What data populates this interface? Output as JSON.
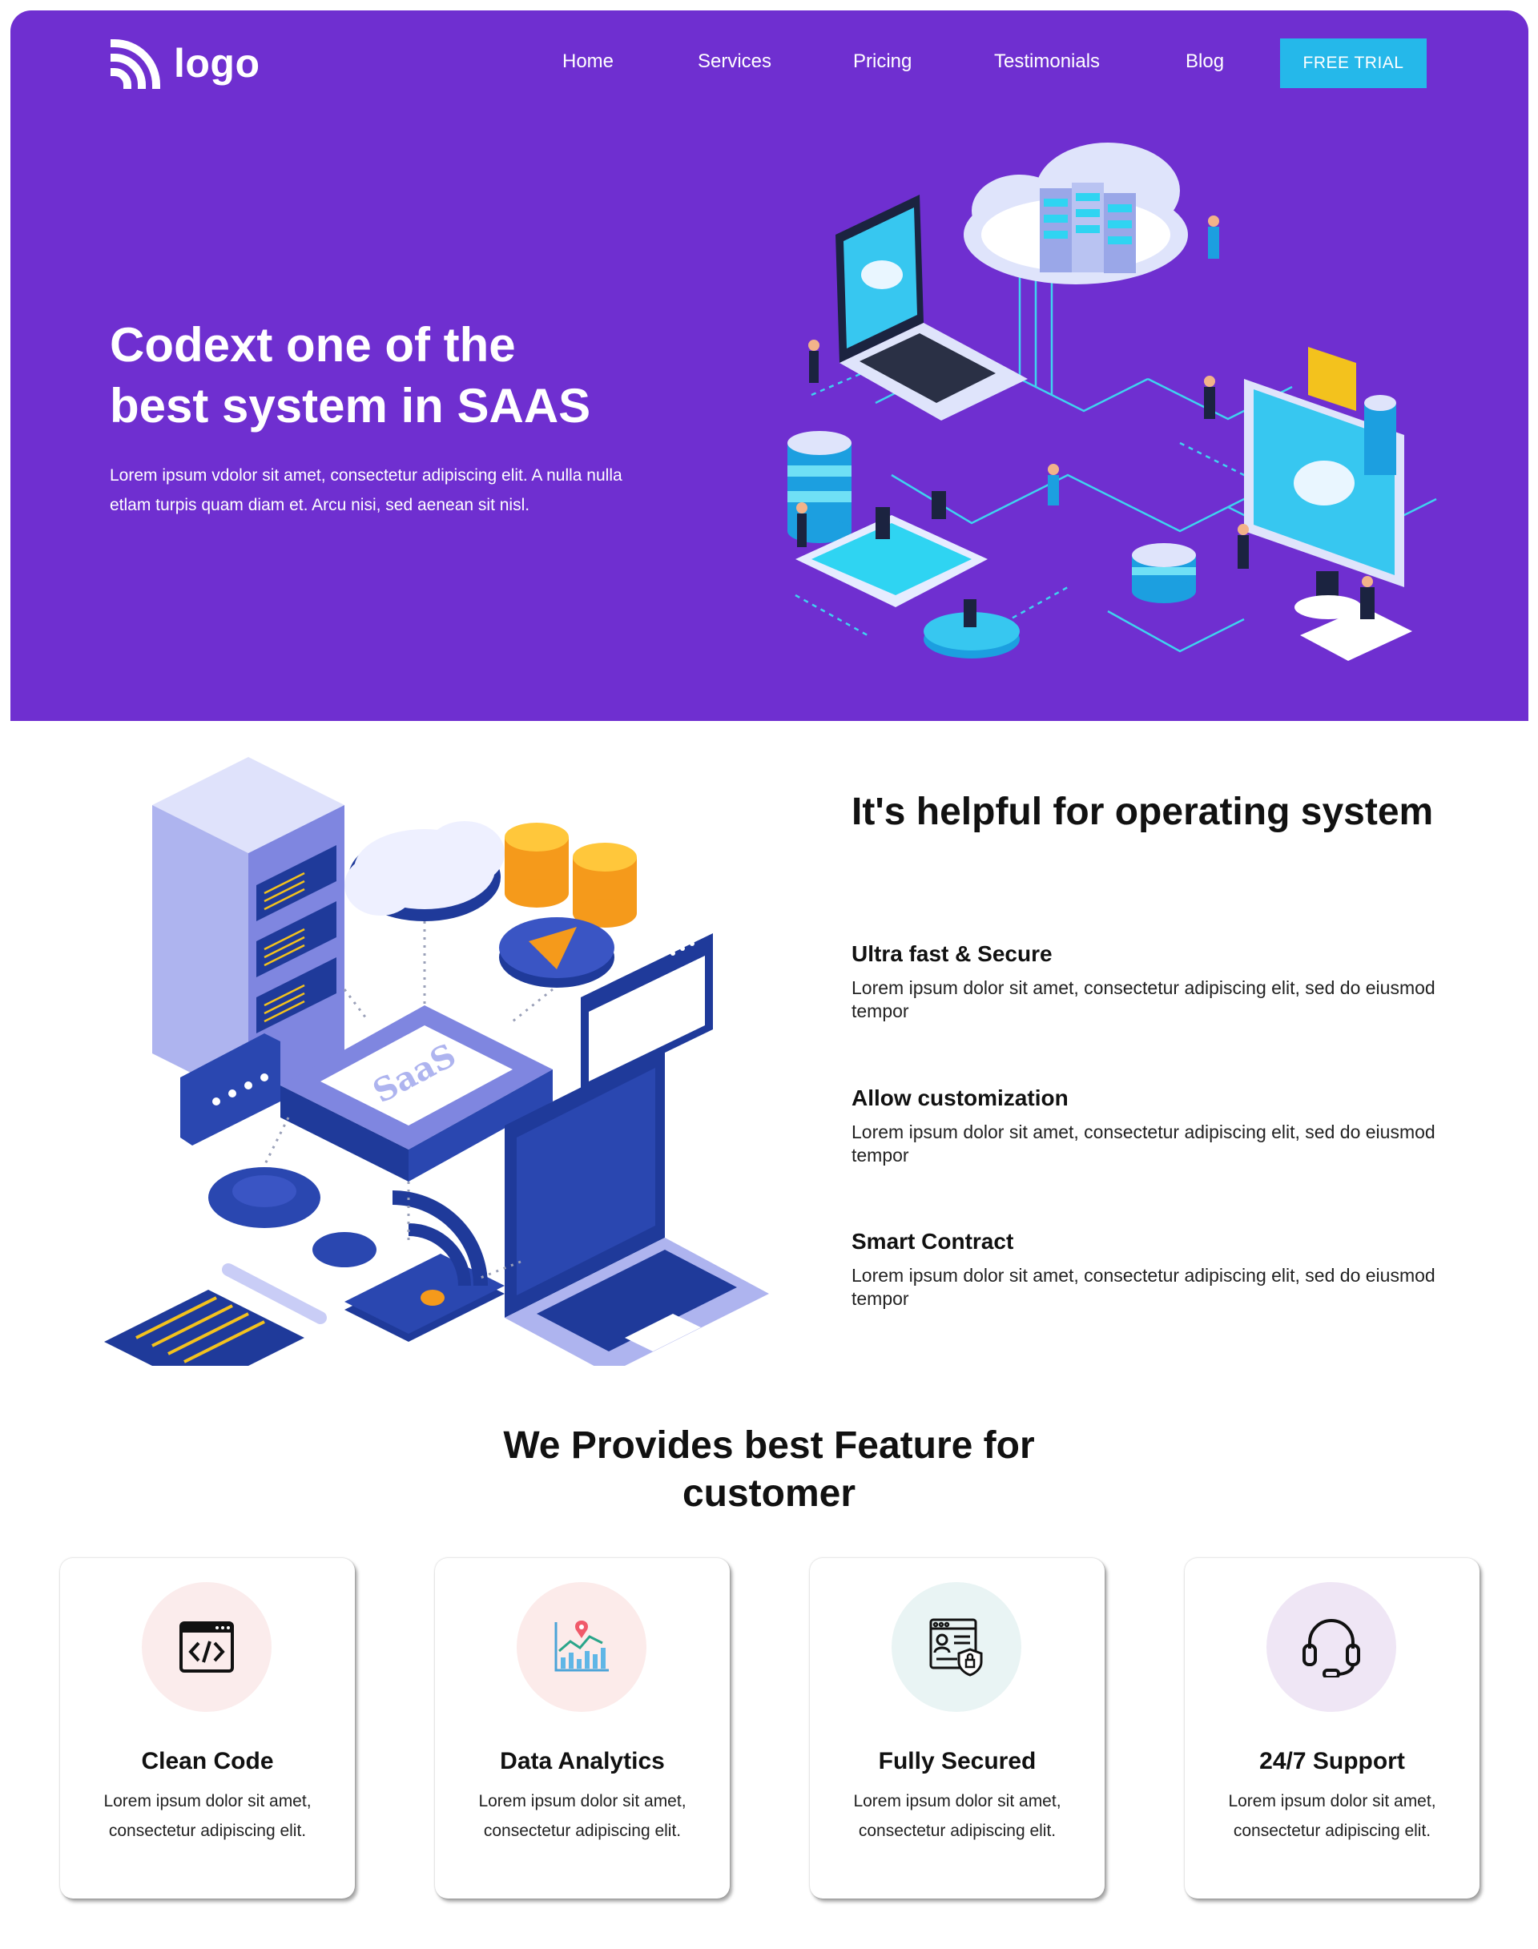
{
  "header": {
    "logo_text": "logo",
    "nav": [
      "Home",
      "Services",
      "Pricing",
      "Testimonials",
      "Blog"
    ],
    "cta_label": "FREE TRIAL"
  },
  "hero": {
    "title_line1": "Codext one of the",
    "title_line2": "best system in SAAS",
    "description": "Lorem ipsum vdolor sit amet, consectetur adipiscing elit. A nulla nulla etlam turpis quam diam et. Arcu nisi, sed aenean sit nisl."
  },
  "about": {
    "illustration_label": "SaaS",
    "heading": "It's helpful for operating system",
    "features": [
      {
        "title": "Ultra fast & Secure",
        "text": "Lorem ipsum dolor sit amet, consectetur adipiscing elit, sed do eiusmod tempor"
      },
      {
        "title": "Allow customization",
        "text": "Lorem ipsum dolor sit amet, consectetur adipiscing elit, sed do eiusmod tempor"
      },
      {
        "title": "Smart Contract",
        "text": "Lorem ipsum dolor sit amet, consectetur adipiscing elit, sed do eiusmod tempor"
      }
    ]
  },
  "features": {
    "heading": "We Provides best Feature for customer",
    "cards": [
      {
        "title": "Clean Code",
        "text": "Lorem ipsum dolor sit amet, consectetur adipiscing elit.",
        "icon": "code-window-icon",
        "bg": "#fbecec"
      },
      {
        "title": "Data Analytics",
        "text": "Lorem ipsum dolor sit amet, consectetur adipiscing elit.",
        "icon": "analytics-chart-icon",
        "bg": "#fcebea"
      },
      {
        "title": "Fully Secured",
        "text": "Lorem ipsum dolor sit amet, consectetur adipiscing elit.",
        "icon": "secure-document-icon",
        "bg": "#e9f4f4"
      },
      {
        "title": "24/7 Support",
        "text": "Lorem ipsum dolor sit amet, consectetur adipiscing elit.",
        "icon": "headset-icon",
        "bg": "#efe6f5"
      }
    ]
  },
  "colors": {
    "hero_bg": "#6f2fd0",
    "cta_bg": "#25b8ea",
    "accent_cyan": "#29d3f0",
    "illustration_blue": "#1f3a9a"
  }
}
